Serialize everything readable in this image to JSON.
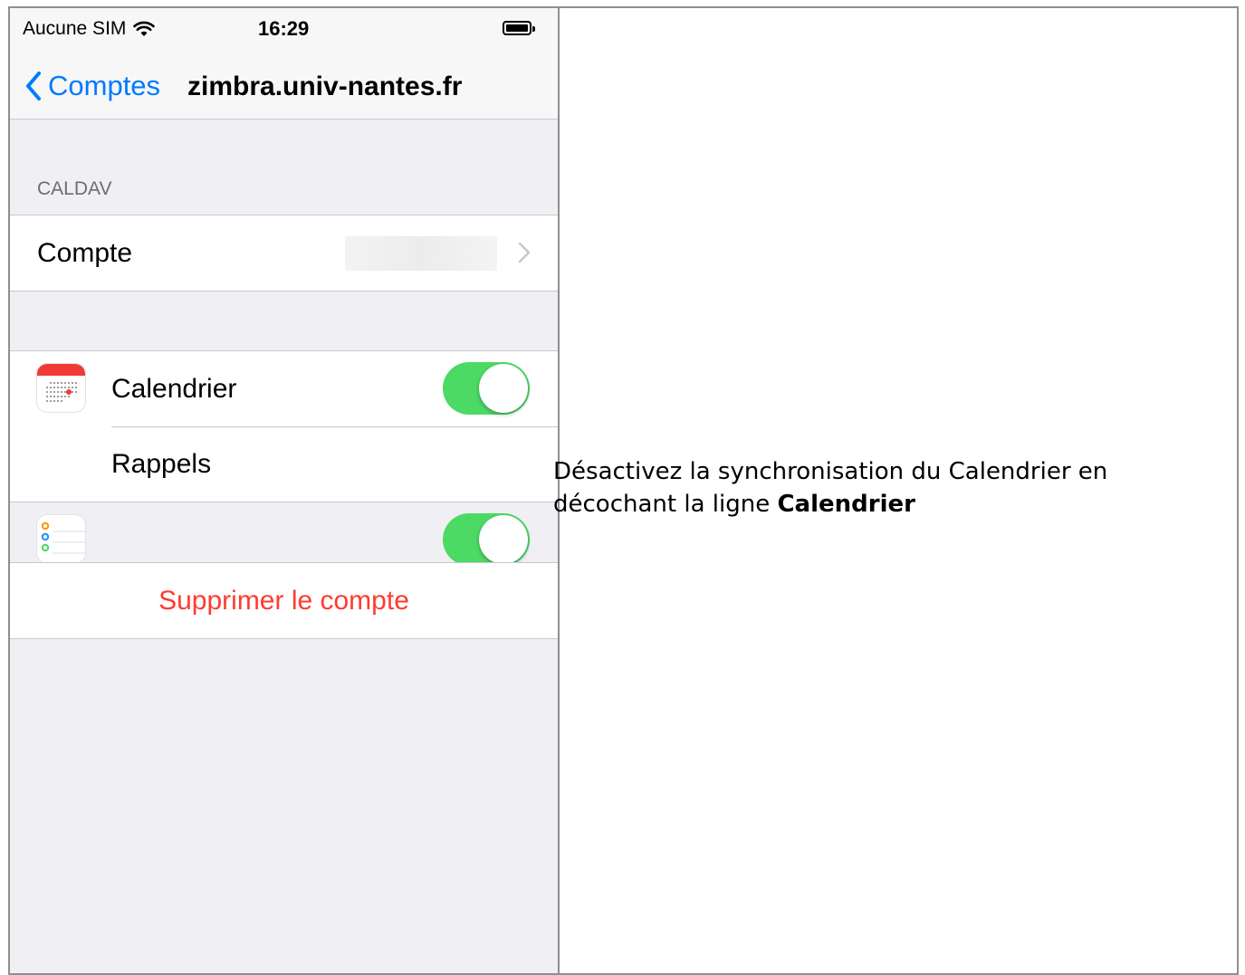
{
  "status_bar": {
    "carrier": "Aucune SIM",
    "time": "16:29"
  },
  "nav": {
    "back_label": "Comptes",
    "title": "zimbra.univ-nantes.fr"
  },
  "section_caldav": {
    "header": "CALDAV",
    "account_label": "Compte"
  },
  "services": [
    {
      "label": "Calendrier",
      "icon": "calendar-icon",
      "enabled": true
    },
    {
      "label": "Rappels",
      "icon": "reminders-icon",
      "enabled": true
    }
  ],
  "delete_button": {
    "label": "Supprimer le compte"
  },
  "instruction": {
    "text_before": "Désactivez la synchronisation du Calendrier en décochant la ligne ",
    "bold": "Calendrier"
  },
  "colors": {
    "accent": "#007aff",
    "toggle_on": "#4cd964",
    "destructive": "#ff3b30",
    "background": "#efeff4"
  }
}
